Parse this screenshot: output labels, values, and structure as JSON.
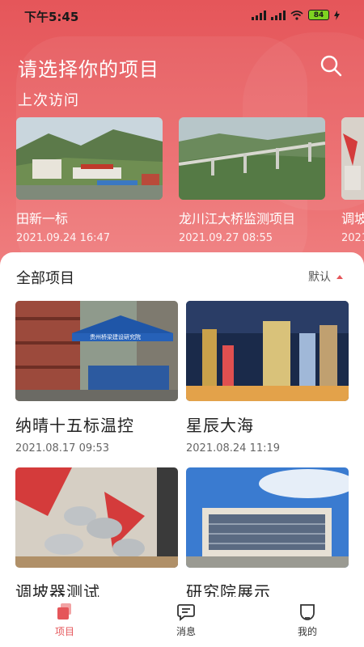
{
  "status_bar": {
    "time": "下午5:45",
    "battery": "84"
  },
  "header": {
    "title": "请选择你的项目",
    "recent_label": "上次访问",
    "search_icon": "search-icon"
  },
  "recent": [
    {
      "name": "田新一标",
      "time": "2021.09.24 16:47"
    },
    {
      "name": "龙川江大桥监测项目",
      "time": "2021.09.27 08:55"
    },
    {
      "name": "调坡",
      "time": "2021"
    }
  ],
  "all_projects": {
    "title": "全部项目",
    "sort_label": "默认",
    "items": [
      {
        "name": "纳晴十五标温控",
        "time": "2021.08.17 09:53",
        "tent_text": "贵州桥梁建设研究院"
      },
      {
        "name": "星辰大海",
        "time": "2021.08.24 11:19"
      },
      {
        "name": "调坡器测试",
        "time": ""
      },
      {
        "name": "研究院展示",
        "time": ""
      }
    ]
  },
  "tabbar": [
    {
      "label": "项目",
      "icon": "project-icon",
      "active": true
    },
    {
      "label": "消息",
      "icon": "message-icon",
      "active": false
    },
    {
      "label": "我的",
      "icon": "profile-icon",
      "active": false
    }
  ],
  "colors": {
    "accent": "#e5565a",
    "hero_top": "#e5565a",
    "text_dark": "#222222"
  }
}
